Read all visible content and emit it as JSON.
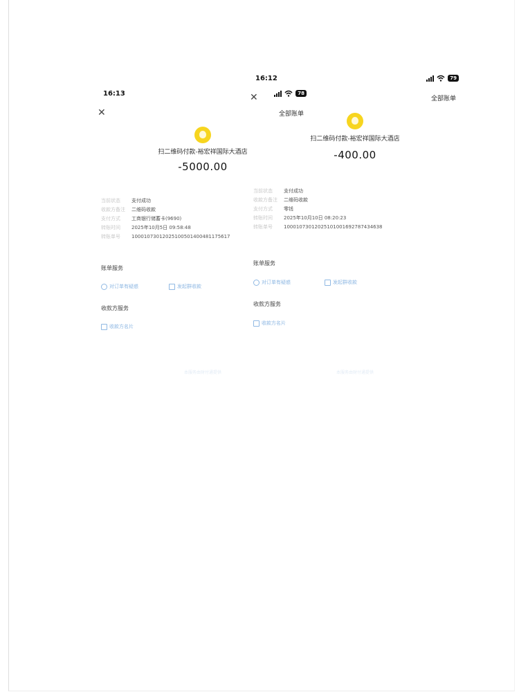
{
  "left": {
    "time": "16:13",
    "battery": "78",
    "all_bills": "全部账单",
    "merchant": "扫二维码付款-裕宏祥国际大酒店",
    "amount": "-5000.00",
    "details": [
      {
        "key": "当前状态",
        "value": "支付成功"
      },
      {
        "key": "收款方备注",
        "value": "二维码收款"
      },
      {
        "key": "支付方式",
        "value": "工商银行储蓄卡(9690)"
      },
      {
        "key": "转账时间",
        "value": "2025年10月5日 09:58:48"
      },
      {
        "key": "转账单号",
        "value": "100010730120251005014004811756​17"
      }
    ],
    "bill_service_title": "账单服务",
    "bill_service_query": "对订单有疑惑",
    "bill_service_repeat": "发起群收款",
    "payee_service_title": "收款方服务",
    "payee_card": "收款方名片",
    "footer": "本服务由财付通提供"
  },
  "right": {
    "time": "16:12",
    "battery": "79",
    "all_bills": "全部账单",
    "merchant": "扫二维码付款-裕宏祥国际大酒店",
    "amount": "-400.00",
    "details": [
      {
        "key": "当前状态",
        "value": "支付成功"
      },
      {
        "key": "收款方备注",
        "value": "二维码收款"
      },
      {
        "key": "支付方式",
        "value": "零钱"
      },
      {
        "key": "转账时间",
        "value": "2025年10月10日 08:20:23"
      },
      {
        "key": "转账单号",
        "value": "1000107301202510100169278743463​8"
      }
    ],
    "bill_service_title": "账单服务",
    "bill_service_query": "对订单有疑惑",
    "bill_service_repeat": "发起群收款",
    "payee_service_title": "收款方服务",
    "payee_card": "收款方名片",
    "footer": "本服务由财付通提供"
  }
}
